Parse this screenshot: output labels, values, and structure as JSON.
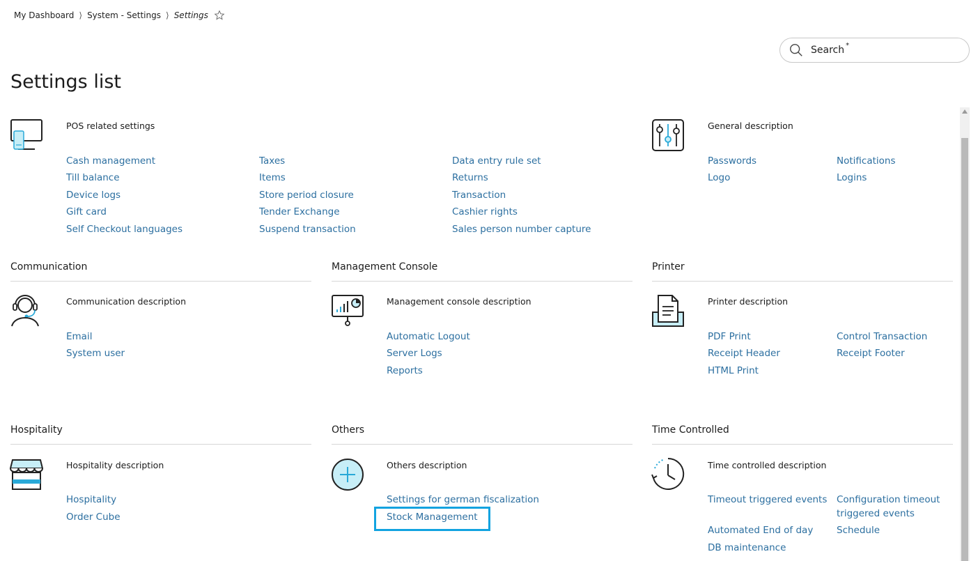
{
  "breadcrumb": {
    "items": [
      "My Dashboard",
      "System - Settings"
    ],
    "current": "Settings",
    "separator": "⟩"
  },
  "search": {
    "placeholder": "Search",
    "required_mark": "*"
  },
  "page_title": "Settings list",
  "sections": {
    "pos": {
      "description": "POS related settings",
      "col1": [
        "Cash management",
        "Till balance",
        "Device logs",
        "Gift card",
        "Self Checkout languages"
      ],
      "col2": [
        "Taxes",
        "Items",
        "Store period closure",
        "Tender Exchange",
        "Suspend transaction"
      ],
      "col3": [
        "Data entry rule set",
        "Returns",
        "Transaction",
        "Cashier rights",
        "Sales person number capture"
      ]
    },
    "general": {
      "description": "General description",
      "col1": [
        "Passwords",
        "Logo"
      ],
      "col2": [
        "Notifications",
        "Logins"
      ]
    },
    "communication": {
      "title": "Communication",
      "description": "Communication description",
      "col1": [
        "Email",
        "System user"
      ]
    },
    "management": {
      "title": "Management Console",
      "description": "Management console description",
      "col1": [
        "Automatic Logout",
        "Server Logs",
        "Reports"
      ]
    },
    "printer": {
      "title": "Printer",
      "description": "Printer description",
      "col1": [
        "PDF Print",
        "Receipt Header",
        "HTML Print"
      ],
      "col2": [
        "Control Transaction",
        "Receipt Footer"
      ]
    },
    "hospitality": {
      "title": "Hospitality",
      "description": "Hospitality description",
      "col1": [
        "Hospitality",
        "Order Cube"
      ]
    },
    "others": {
      "title": "Others",
      "description": "Others description",
      "col1": [
        "Settings for german fiscalization",
        "Stock Management"
      ]
    },
    "time": {
      "title": "Time Controlled",
      "description": "Time controlled description",
      "col1": [
        "Timeout triggered events",
        "Automated End of day",
        "DB maintenance"
      ],
      "col2": [
        "Configuration timeout triggered events",
        "Schedule"
      ]
    }
  },
  "colors": {
    "link": "#2c6fa0",
    "accent": "#12a3e0",
    "icon_fill": "#c7eef7"
  },
  "icons": [
    "pos-terminal-icon",
    "sliders-icon",
    "headset-icon",
    "monitor-chart-icon",
    "printer-icon",
    "storefront-icon",
    "plus-circle-icon",
    "clock-icon",
    "search-icon",
    "star-icon"
  ]
}
